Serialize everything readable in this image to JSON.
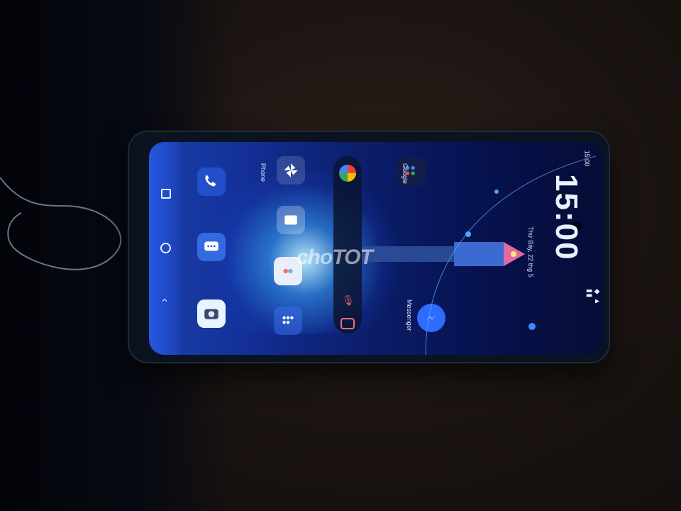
{
  "status_bar": {
    "time": "15:00",
    "icons": "◆ ▲ ▮▮"
  },
  "lock_clock": {
    "time": "15:00",
    "date": "Thứ Bảy, 22 thg 5"
  },
  "home_apps": {
    "google_label": "Google",
    "phone_label": "Phone",
    "messenger_label": "Messenger"
  },
  "watermark": {
    "text": "choTOT"
  },
  "colors": {
    "screen_blue": "#14329c",
    "glow": "#bef0ff",
    "wood": "#1c1512"
  },
  "icons": {
    "nav_recent": "square-icon",
    "nav_home": "circle-icon",
    "nav_back": "chevron-icon"
  }
}
